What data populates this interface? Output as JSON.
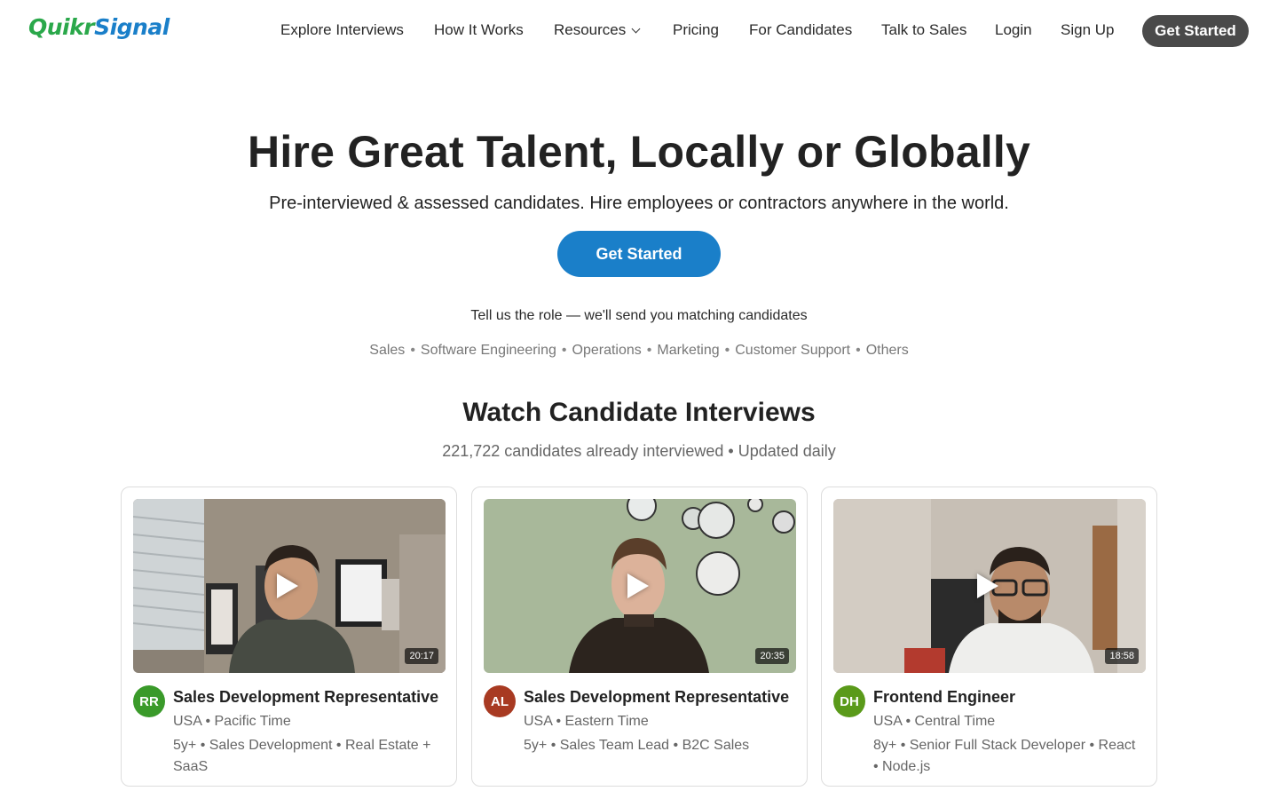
{
  "header": {
    "logo_part1": "Quikr",
    "logo_part2": "Signal",
    "nav": [
      {
        "label": "Explore Interviews"
      },
      {
        "label": "How It Works"
      },
      {
        "label": "Resources"
      },
      {
        "label": "Pricing"
      },
      {
        "label": "For Candidates"
      },
      {
        "label": "Talk to Sales"
      },
      {
        "label": "Login"
      },
      {
        "label": "Sign Up"
      }
    ],
    "cta_label": "Get Started"
  },
  "hero": {
    "title": "Hire Great Talent, Locally or Globally",
    "subtitle": "Pre-interviewed & assessed candidates. Hire employees or contractors anywhere in the world.",
    "cta_label": "Get Started",
    "tell_us": "Tell us the role — we'll send you matching candidates",
    "roles": [
      "Sales",
      "Software Engineering",
      "Operations",
      "Marketing",
      "Customer Support",
      "Others"
    ]
  },
  "interviews": {
    "title": "Watch Candidate Interviews",
    "subtitle": "221,722 candidates already interviewed • Updated daily",
    "cards": [
      {
        "initials": "RR",
        "avatar_color": "#3a9a2a",
        "title": "Sales Development Representative",
        "location": "USA • Pacific Time",
        "tags": "5y+ • Sales Development • Real Estate + SaaS",
        "duration": "20:17"
      },
      {
        "initials": "AL",
        "avatar_color": "#a83a22",
        "title": "Sales Development Representative",
        "location": "USA • Eastern Time",
        "tags": "5y+ • Sales Team Lead • B2C Sales",
        "duration": "20:35"
      },
      {
        "initials": "DH",
        "avatar_color": "#5a9a1a",
        "title": "Frontend Engineer",
        "location": "USA • Central Time",
        "tags": "8y+ • Senior Full Stack Developer • React • Node.js",
        "duration": "18:58"
      }
    ]
  }
}
